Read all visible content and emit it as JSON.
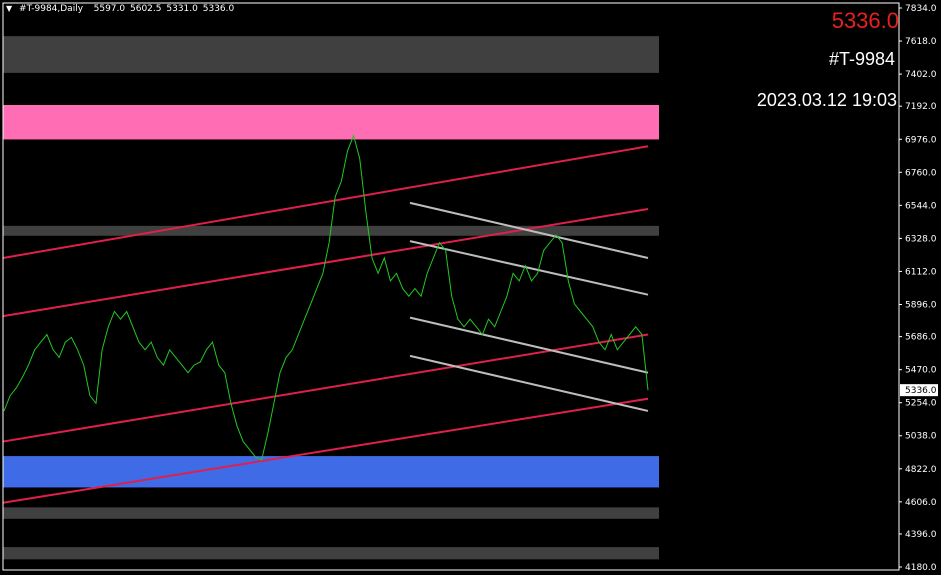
{
  "header": {
    "symbol_tf": "#T-9984,Daily",
    "open": "5597.0",
    "high": "5602.5",
    "low": "5331.0",
    "close": "5336.0"
  },
  "overlay": {
    "price": "5336.0",
    "symbol": "#T-9984",
    "datetime": "2023.03.12 19:03"
  },
  "colors": {
    "background": "#000000",
    "price_line": "#22c922",
    "red_channel": "#e0204a",
    "gray_channel": "#bdbdbd",
    "pink_zone": "#ff6eb4",
    "blue_zone": "#3f6be6",
    "gray_zone": "#404040",
    "current_price_text": "#e8201e"
  },
  "chart_data": {
    "type": "line",
    "series": [
      {
        "values": [
          5200,
          5300,
          5350,
          5420,
          5500,
          5600,
          5650,
          5700,
          5600,
          5550,
          5650,
          5680,
          5600,
          5500,
          5300,
          5250,
          5600,
          5750,
          5850,
          5800,
          5850,
          5750,
          5650,
          5600,
          5650,
          5550,
          5500,
          5600,
          5550,
          5500,
          5450,
          5500,
          5520,
          5600,
          5650,
          5500,
          5450,
          5250,
          5100,
          5000,
          4950,
          4900,
          4880,
          5050,
          5250,
          5450,
          5550,
          5600,
          5700,
          5800,
          5900,
          6000,
          6100,
          6300,
          6600,
          6700,
          6900,
          7000,
          6850,
          6500,
          6200,
          6100,
          6200,
          6050,
          6100,
          6000,
          5950,
          6000,
          5950,
          6100,
          6200,
          6300,
          6250,
          5950,
          5800,
          5750,
          5800,
          5750,
          5700,
          5800,
          5750,
          5850,
          5950,
          6100,
          6050,
          6150,
          6050,
          6100,
          6250,
          6300,
          6350,
          6300,
          6050,
          5900,
          5850,
          5800,
          5750,
          5650,
          5600,
          5700,
          5600,
          5650,
          5700,
          5750,
          5700,
          5336
        ]
      }
    ],
    "y_ticks": [
      "7834.0",
      "7618.0",
      "7402.0",
      "7192.0",
      "6976.0",
      "6760.0",
      "6544.0",
      "6328.0",
      "6112.0",
      "5896.0",
      "5686.0",
      "5470.0",
      "5254.0",
      "5038.0",
      "4822.0",
      "4606.0",
      "4396.0",
      "4180.0"
    ],
    "ylim": [
      4180,
      7834
    ],
    "current_price": 5336.0,
    "current_price_label": "5336.0",
    "zones": [
      {
        "color": "gray",
        "y_top": 7650,
        "y_bottom": 7410
      },
      {
        "color": "pink",
        "y_top": 7200,
        "y_bottom": 6975
      },
      {
        "color": "gray",
        "y_top": 6410,
        "y_bottom": 6345
      },
      {
        "color": "blue",
        "y_top": 4905,
        "y_bottom": 4700
      },
      {
        "color": "gray",
        "y_top": 4570,
        "y_bottom": 4495
      },
      {
        "color": "gray",
        "y_top": 4310,
        "y_bottom": 4230
      }
    ],
    "red_channel_lines": [
      {
        "x_start": 0,
        "x_end": 1,
        "y_start": 6200,
        "y_end": 6930
      },
      {
        "x_start": 0,
        "x_end": 1,
        "y_start": 5820,
        "y_end": 6520
      },
      {
        "x_start": 0,
        "x_end": 1,
        "y_start": 5000,
        "y_end": 5700
      },
      {
        "x_start": 0,
        "x_end": 1,
        "y_start": 4600,
        "y_end": 5280
      }
    ],
    "gray_channel_lines": [
      {
        "x_start": 0.63,
        "x_end": 1,
        "y_start": 6560,
        "y_end": 6200
      },
      {
        "x_start": 0.63,
        "x_end": 1,
        "y_start": 6310,
        "y_end": 5960
      },
      {
        "x_start": 0.63,
        "x_end": 1,
        "y_start": 5810,
        "y_end": 5450
      },
      {
        "x_start": 0.63,
        "x_end": 1,
        "y_start": 5560,
        "y_end": 5200
      }
    ]
  }
}
